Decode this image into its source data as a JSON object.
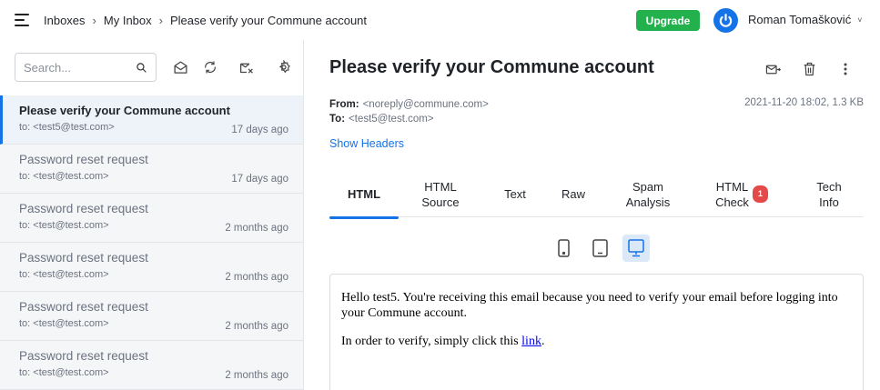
{
  "breadcrumbs": [
    "Inboxes",
    "My Inbox",
    "Please verify your Commune account"
  ],
  "breadcrumb_separator": "›",
  "upgrade_label": "Upgrade",
  "user": {
    "name": "Roman Tomašković",
    "chevron": "˅"
  },
  "search": {
    "placeholder": "Search..."
  },
  "toolbar_icons": [
    "search-icon",
    "mailbox-icon",
    "refresh-icon",
    "clear-inbox-icon",
    "settings-icon"
  ],
  "messages": [
    {
      "subject": "Please verify your Commune account",
      "to": "to: <test5@test.com>",
      "when": "17 days ago",
      "active": true
    },
    {
      "subject": "Password reset request",
      "to": "to: <test@test.com>",
      "when": "17 days ago"
    },
    {
      "subject": "Password reset request",
      "to": "to: <test@test.com>",
      "when": "2 months ago"
    },
    {
      "subject": "Password reset request",
      "to": "to: <test@test.com>",
      "when": "2 months ago"
    },
    {
      "subject": "Password reset request",
      "to": "to: <test@test.com>",
      "when": "2 months ago"
    },
    {
      "subject": "Password reset request",
      "to": "to: <test@test.com>",
      "when": "2 months ago"
    }
  ],
  "email": {
    "title": "Please verify your Commune account",
    "from_label": "From:",
    "from": "<noreply@commune.com>",
    "to_label": "To:",
    "to": "<test5@test.com>",
    "date_size": "2021-11-20 18:02, 1.3 KB",
    "show_headers": "Show Headers",
    "actions": [
      "forward-icon",
      "trash-icon",
      "more-vertical-icon"
    ]
  },
  "tabs": [
    {
      "line1": "HTML",
      "line2": "",
      "active": true
    },
    {
      "line1": "HTML",
      "line2": "Source"
    },
    {
      "line1": "Text",
      "line2": ""
    },
    {
      "line1": "Raw",
      "line2": ""
    },
    {
      "line1": "Spam",
      "line2": "Analysis"
    },
    {
      "line1": "HTML",
      "line2": "Check",
      "badge": "1"
    },
    {
      "line1": "Tech",
      "line2": "Info"
    }
  ],
  "devices": [
    "phone-icon",
    "tablet-icon",
    "desktop-icon"
  ],
  "body": {
    "p1": "Hello test5. You're receiving this email because you need to verify your email before logging into your Commune account.",
    "p2_before": "In order to verify, simply click this ",
    "p2_link": "link",
    "p2_after": "."
  },
  "colors": {
    "accent": "#1473e6",
    "upgrade": "#22b14c",
    "badge": "#e34a4a"
  }
}
